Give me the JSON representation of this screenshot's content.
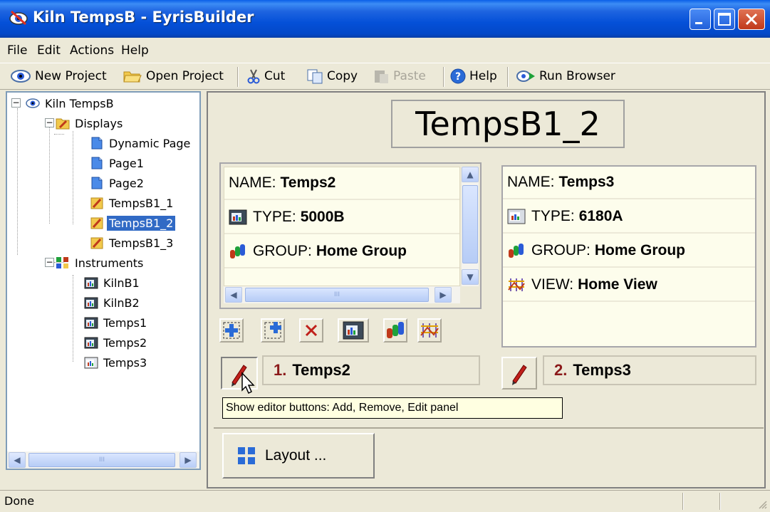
{
  "window": {
    "title": "Kiln TempsB - EyrisBuilder"
  },
  "menu": [
    "File",
    "Edit",
    "Actions",
    "Help"
  ],
  "toolbar": {
    "new_project": "New Project",
    "open_project": "Open Project",
    "cut": "Cut",
    "copy": "Copy",
    "paste": "Paste",
    "help": "Help",
    "run_browser": "Run Browser"
  },
  "tree": {
    "root": "Kiln TempsB",
    "displays_label": "Displays",
    "displays": [
      "Dynamic Page",
      "Page1",
      "Page2",
      "TempsB1_1",
      "TempsB1_2",
      "TempsB1_3"
    ],
    "selected": "TempsB1_2",
    "instruments_label": "Instruments",
    "instruments": [
      "KilnB1",
      "KilnB2",
      "Temps1",
      "Temps2",
      "Temps3"
    ]
  },
  "page": {
    "title": "TempsB1_2"
  },
  "panel1": {
    "name_label": "NAME:",
    "name": "Temps2",
    "type_label": "TYPE:",
    "type": "5000B",
    "group_label": "GROUP:",
    "group": "Home Group",
    "slot_number": "1.",
    "slot_name": "Temps2"
  },
  "panel2": {
    "name_label": "NAME:",
    "name": "Temps3",
    "type_label": "TYPE:",
    "type": "6180A",
    "group_label": "GROUP:",
    "group": "Home Group",
    "view_label": "VIEW:",
    "view": "Home View",
    "slot_number": "2.",
    "slot_name": "Temps3"
  },
  "tooltip": "Show editor buttons: Add, Remove, Edit panel",
  "layout_button": "Layout ...",
  "status": {
    "text": "Done"
  },
  "scroll_grip": "III",
  "colors": {
    "selection": "#316AC5",
    "card": "#FDFDEC",
    "slot_number": "#8B1A1A",
    "titlebar": "#0450D8"
  }
}
